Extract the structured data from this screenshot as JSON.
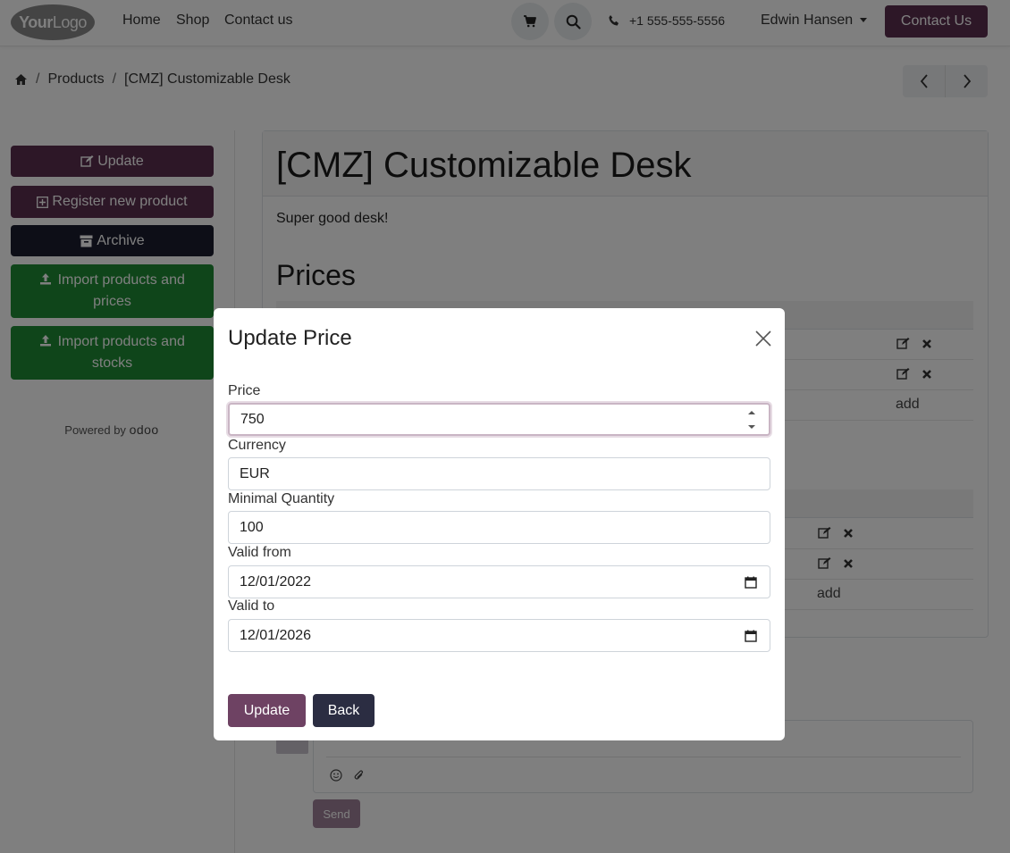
{
  "nav": {
    "logo_bold": "Your",
    "logo_thin": "Logo",
    "links": [
      "Home",
      "Shop",
      "Contact us"
    ],
    "phone": "+1 555-555-5556",
    "user": "Edwin Hansen",
    "cta": "Contact Us"
  },
  "breadcrumb": {
    "items": [
      "Products",
      "[CMZ] Customizable Desk"
    ]
  },
  "sidebar": {
    "update": "Update",
    "register": "Register new product",
    "archive": "Archive",
    "import_prices": "Import products and prices",
    "import_stocks": "Import products and stocks",
    "powered_by": "Powered by",
    "powered_brand": "odoo"
  },
  "product": {
    "title": "[CMZ] Customizable Desk",
    "description": "Super good desk!",
    "prices_heading": "Prices",
    "add_label": "add"
  },
  "chatter": {
    "send": "Send"
  },
  "modal": {
    "title": "Update Price",
    "fields": {
      "price": {
        "label": "Price",
        "value": "750"
      },
      "currency": {
        "label": "Currency",
        "value": "EUR"
      },
      "min_qty": {
        "label": "Minimal Quantity",
        "value": "100"
      },
      "valid_from": {
        "label": "Valid from",
        "value": "12/01/2022"
      },
      "valid_to": {
        "label": "Valid to",
        "value": "12/01/2026"
      }
    },
    "update_button": "Update",
    "back_button": "Back"
  },
  "colors": {
    "primary": "#5a2e4f",
    "dark": "#1a1d2e",
    "success": "#1e8a35",
    "modal_primary": "#6e4263",
    "modal_secondary": "#2b2d42"
  },
  "icons": [
    "cart-icon",
    "search-icon",
    "phone-icon",
    "home-icon",
    "chevron-left-icon",
    "chevron-right-icon",
    "edit-icon",
    "delete-icon",
    "plus-square-icon",
    "archive-icon",
    "upload-icon",
    "close-icon",
    "calendar-icon",
    "smiley-icon",
    "paperclip-icon"
  ]
}
